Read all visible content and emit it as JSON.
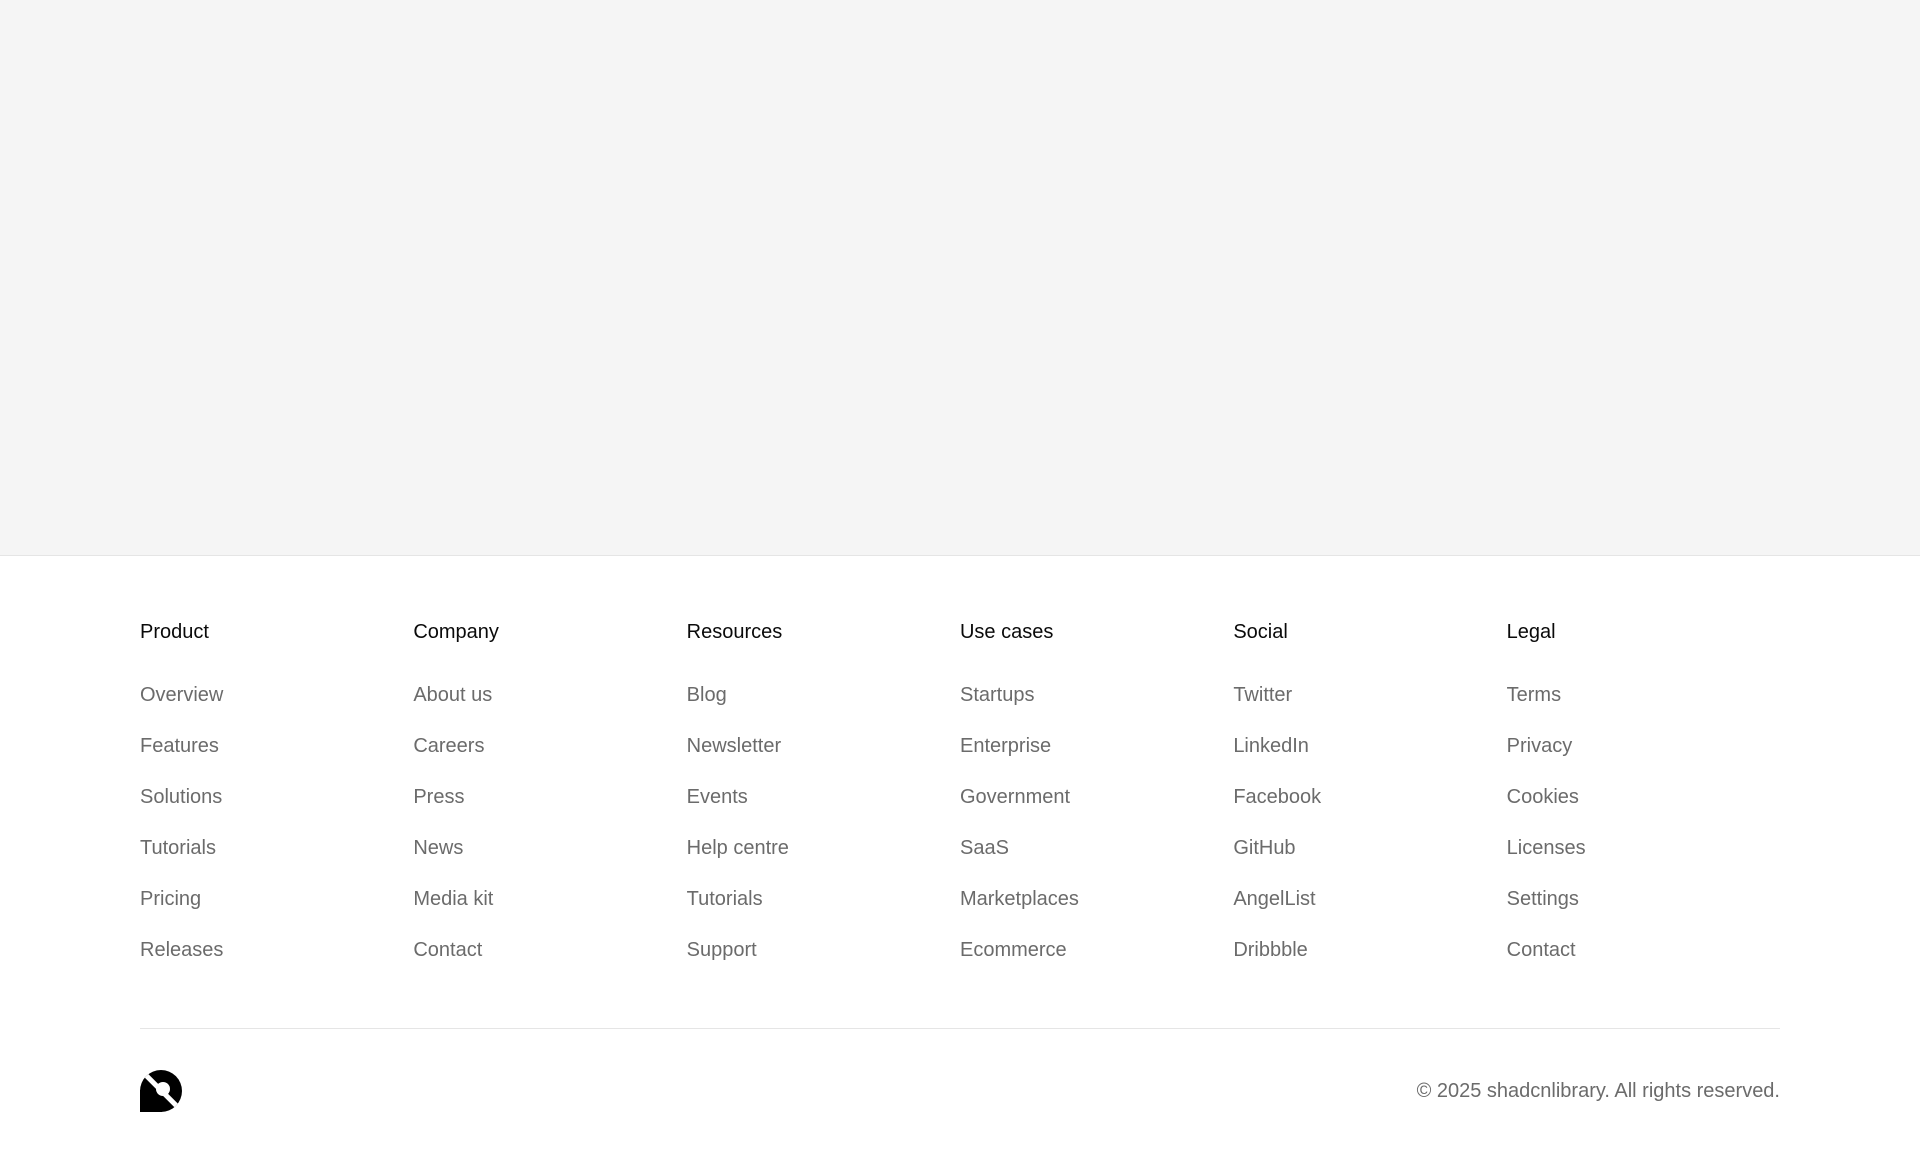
{
  "footer": {
    "columns": [
      {
        "title": "Product",
        "links": [
          "Overview",
          "Features",
          "Solutions",
          "Tutorials",
          "Pricing",
          "Releases"
        ]
      },
      {
        "title": "Company",
        "links": [
          "About us",
          "Careers",
          "Press",
          "News",
          "Media kit",
          "Contact"
        ]
      },
      {
        "title": "Resources",
        "links": [
          "Blog",
          "Newsletter",
          "Events",
          "Help centre",
          "Tutorials",
          "Support"
        ]
      },
      {
        "title": "Use cases",
        "links": [
          "Startups",
          "Enterprise",
          "Government",
          "SaaS",
          "Marketplaces",
          "Ecommerce"
        ]
      },
      {
        "title": "Social",
        "links": [
          "Twitter",
          "LinkedIn",
          "Facebook",
          "GitHub",
          "AngelList",
          "Dribbble"
        ]
      },
      {
        "title": "Legal",
        "links": [
          "Terms",
          "Privacy",
          "Cookies",
          "Licenses",
          "Settings",
          "Contact"
        ]
      }
    ],
    "logo_icon": "brand-logo-icon",
    "copyright": "© 2025 shadcnlibrary. All rights reserved."
  },
  "colors": {
    "hero_background": "#f5f5f5",
    "heading_text": "#0a0a0a",
    "link_text": "#6b6b6b",
    "divider": "#e5e5e5"
  }
}
